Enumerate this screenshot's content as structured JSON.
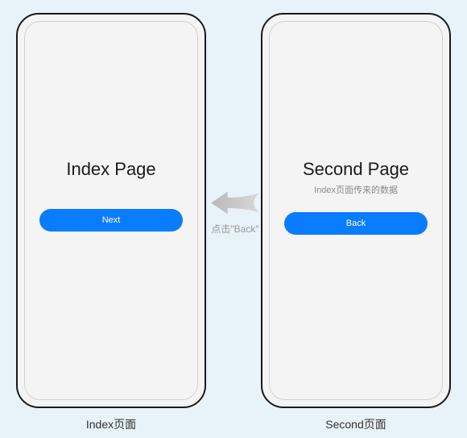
{
  "left_phone": {
    "title": "Index Page",
    "button_label": "Next",
    "caption": "Index页面"
  },
  "right_phone": {
    "title": "Second Page",
    "subtitle": "Index页面传来的数据",
    "button_label": "Back",
    "caption": "Second页面"
  },
  "arrow": {
    "label": "点击\"Back\""
  }
}
